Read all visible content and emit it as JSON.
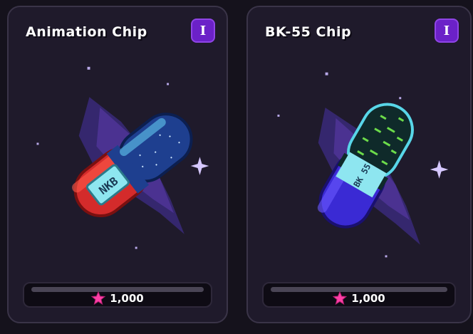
{
  "cards": [
    {
      "title": "Animation Chip",
      "tier": "I",
      "price": "1,000",
      "capsule_top_color": "#1e3f8f",
      "capsule_bottom_color": "#d42b2b",
      "label_text": "NKB",
      "currency_icon": "pink-star-icon"
    },
    {
      "title": "BK-55 Chip",
      "tier": "I",
      "price": "1,000",
      "capsule_top_color": "#0f2a2a",
      "capsule_bottom_color": "#3a2ad4",
      "label_text": "BK 55",
      "currency_icon": "pink-star-icon"
    }
  ],
  "colors": {
    "background": "#15121c",
    "card": "#1f1a2b",
    "badge": "#6b21c8",
    "star": "#ff3fa6"
  }
}
